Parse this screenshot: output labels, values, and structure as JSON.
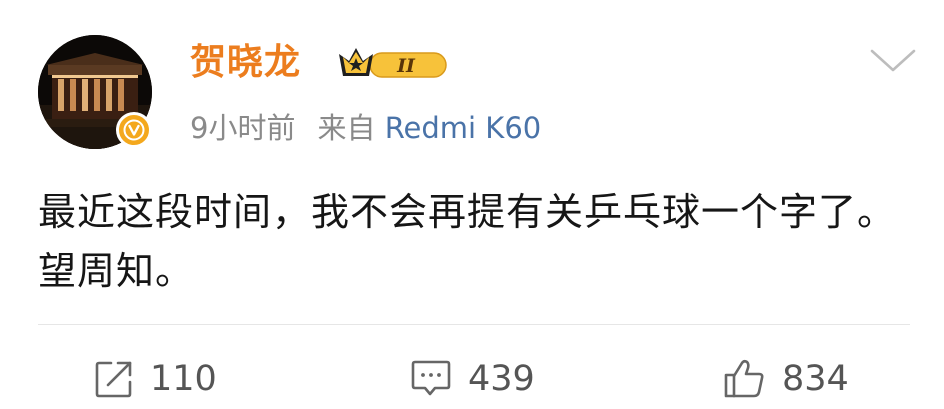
{
  "post": {
    "author": {
      "name": "贺晓龙",
      "avatar_icon": "avatar-photo-building-at-night",
      "verified_icon": "verified-v-icon",
      "badge_icon": "crown-vip-badge",
      "badge_level": "II"
    },
    "time": "9小时前",
    "source_prefix": "来自",
    "device": "Redmi K60",
    "text": "最近这段时间，我不会再提有关乒乓球一个字了。望周知。"
  },
  "actions": {
    "repost": {
      "icon": "repost-icon",
      "count": "110"
    },
    "comment": {
      "icon": "comment-icon",
      "count": "439"
    },
    "like": {
      "icon": "thumbs-up-icon",
      "count": "834"
    }
  },
  "colors": {
    "username": "#ec7d1e",
    "device_link": "#4a73a8",
    "meta_gray": "#8a8a8a",
    "verified_badge": "#f4a81d"
  }
}
